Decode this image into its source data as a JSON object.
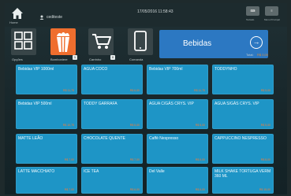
{
  "topbar": {
    "home_label": "Home",
    "user_name": "cediteste",
    "datetime": "17/05/2016 11:58:43",
    "sys_buttons": [
      {
        "icon": "keyboard-icon",
        "label": "Teclado"
      },
      {
        "icon": "menu-icon",
        "label": "Menu Principal"
      }
    ]
  },
  "actions": {
    "opcoes_label": "Opções",
    "bomboniere_label": "Bomboniere",
    "carrinho_label": "Carrinho",
    "carrinho_badge": "0",
    "comanda_label": "Comanda",
    "bomboniere_badge": "1"
  },
  "category": {
    "label": "Bebidas",
    "next_icon": "arrow-right-circle-icon",
    "color": "#2c78c2"
  },
  "total": {
    "label": "Total:",
    "value": "R$ 0,00"
  },
  "products": [
    {
      "name": "Bebidas VIP 1000ml",
      "price": "R$ 11,75"
    },
    {
      "name": "AGUA COCO",
      "price": "R$ 6,00"
    },
    {
      "name": "Bebidas VIP 700ml",
      "price": "R$ 11,75"
    },
    {
      "name": "TODDYNHO",
      "price": "R$ 5,00"
    },
    {
      "name": "Bebidas VIP 500ml",
      "price": "R$ 10,75"
    },
    {
      "name": "TODDY GARRAFA",
      "price": "R$ 6,00"
    },
    {
      "name": "AGUA C/GÁS CRYS. VIP",
      "price": "R$ 6,00"
    },
    {
      "name": "AGUA S/GÁS CRYS. VIP",
      "price": "R$ 5,00"
    },
    {
      "name": "MATTE LEÃO",
      "price": "R$ 7,00"
    },
    {
      "name": "CHOCOLATE QUENTE",
      "price": "R$ 7,00"
    },
    {
      "name": "Caffè Nespresso",
      "price": "R$ 6,00"
    },
    {
      "name": "CAPPUCCINO NESPRESSO",
      "price": "R$ 8,00"
    },
    {
      "name": "LATTE MACCHIATO",
      "price": "R$ 7,00"
    },
    {
      "name": "ICE TEA",
      "price": "R$ 6,00"
    },
    {
      "name": "Del Valle",
      "price": "R$ 6,00"
    },
    {
      "name": "MILK SHAKE TORTUGA VERM 360 ML",
      "price": "R$ 15,00"
    }
  ]
}
